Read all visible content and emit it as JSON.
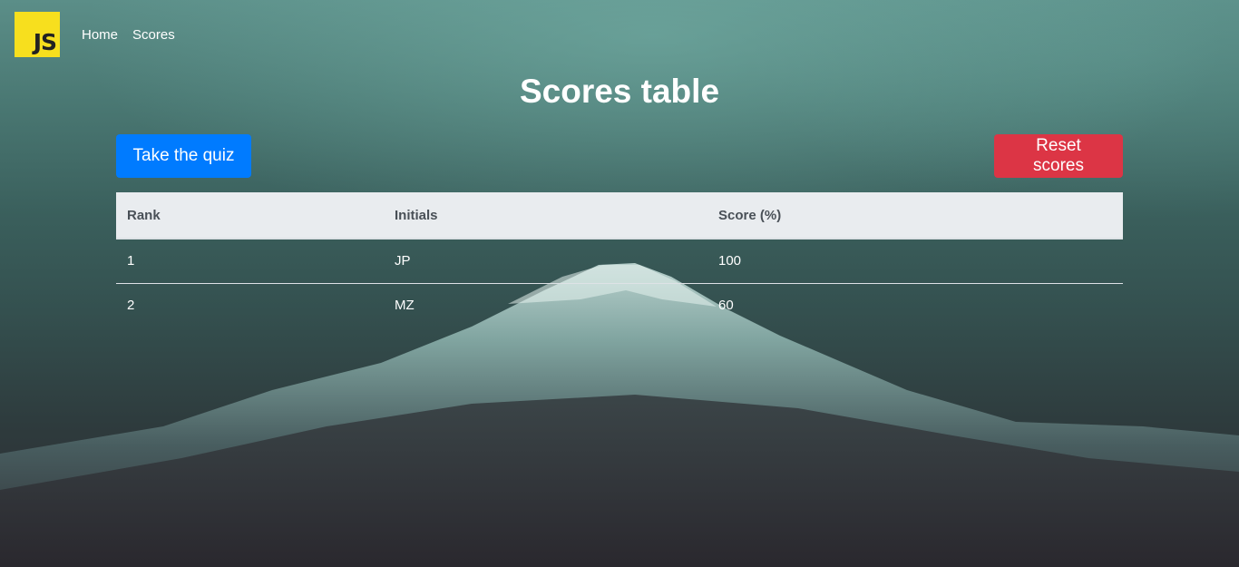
{
  "navbar": {
    "logo_text": "JS",
    "links": [
      {
        "label": "Home"
      },
      {
        "label": "Scores"
      }
    ]
  },
  "page": {
    "title": "Scores table"
  },
  "actions": {
    "take_quiz_label": "Take the quiz",
    "reset_scores_label": "Reset scores"
  },
  "table": {
    "headers": [
      "Rank",
      "Initials",
      "Score (%)"
    ],
    "rows": [
      {
        "rank": "1",
        "initials": "JP",
        "score": "100"
      },
      {
        "rank": "2",
        "initials": "MZ",
        "score": "60"
      }
    ]
  },
  "colors": {
    "logo_bg": "#f7df1e",
    "primary": "#007bff",
    "danger": "#dc3545",
    "table_header_bg": "#e9ecef"
  }
}
